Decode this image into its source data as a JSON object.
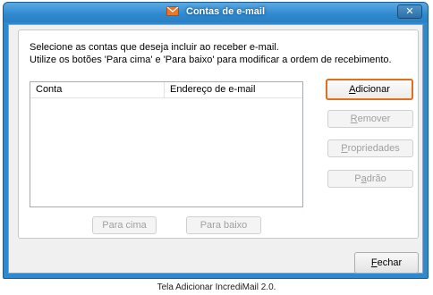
{
  "window": {
    "title": "Contas de e-mail",
    "close_symbol": "✕"
  },
  "instructions": {
    "line1": "Selecione as contas que deseja incluir ao receber e-mail.",
    "line2": "Utilize os botões 'Para cima' e 'Para baixo' para modificar a ordem de recebimento."
  },
  "list": {
    "columns": [
      "Conta",
      "Endereço de e-mail"
    ],
    "rows": []
  },
  "buttons": {
    "add": {
      "accel": "A",
      "rest": "dicionar"
    },
    "remove": {
      "accel": "R",
      "rest": "emover"
    },
    "properties": {
      "accel": "P",
      "rest": "ropriedades"
    },
    "default": {
      "pre": "P",
      "accel": "a",
      "rest": "drão"
    },
    "up": "Para cima",
    "down": "Para baixo",
    "close": {
      "accel": "F",
      "rest": "echar"
    }
  },
  "caption": "Tela Adicionar IncrediMail 2.0.",
  "colors": {
    "titlebar": "#2f89cf",
    "focus_border": "#e07020",
    "mail_icon": "#e8762b"
  },
  "icons": [
    "mail-envelope-icon",
    "close-icon"
  ]
}
